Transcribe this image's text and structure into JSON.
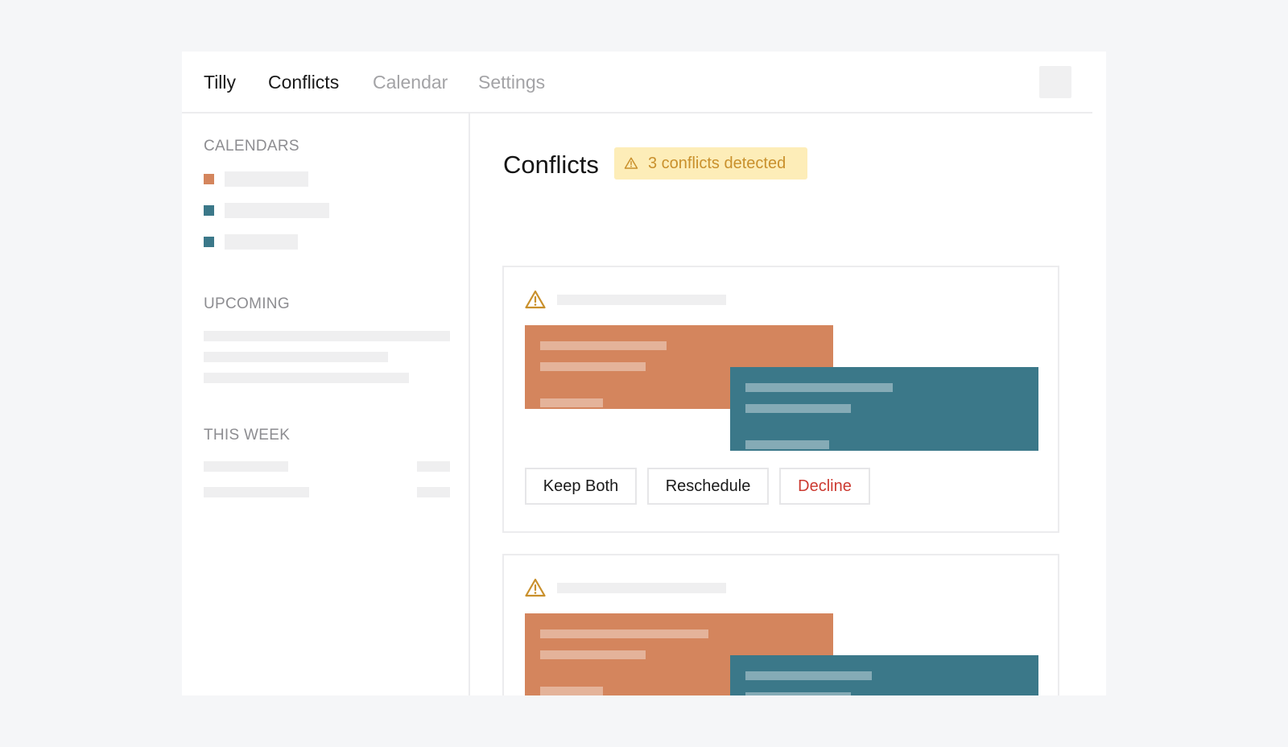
{
  "nav": {
    "brand": "Tilly",
    "items": [
      {
        "label": "Conflicts",
        "active": true
      },
      {
        "label": "Calendar",
        "active": false
      },
      {
        "label": "Settings",
        "active": false
      }
    ]
  },
  "sidebar": {
    "calendars_label": "CALENDARS",
    "calendar_colors": [
      "#d4855d",
      "#3b7889",
      "#3b7889"
    ],
    "upcoming_label": "UPCOMING",
    "this_week_label": "THIS WEEK"
  },
  "main": {
    "title": "Conflicts",
    "badge": "3 conflicts detected",
    "actions": {
      "keep_both": "Keep Both",
      "reschedule": "Reschedule",
      "decline": "Decline"
    }
  },
  "colors": {
    "accent_orange": "#d4855d",
    "accent_teal": "#3b7889",
    "warning": "#c9902c",
    "warning_bg": "#fdedb8",
    "danger": "#cc3b32"
  },
  "icons": {
    "badge": "warning-icon",
    "card": "warning-icon"
  }
}
